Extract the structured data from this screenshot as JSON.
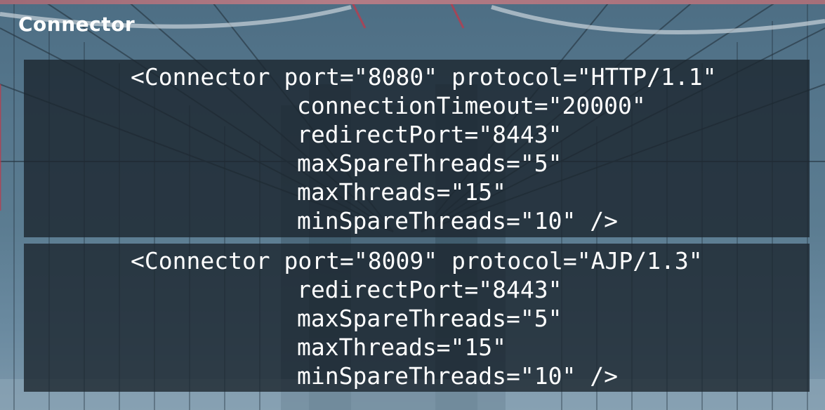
{
  "slide": {
    "title": "Connector",
    "code_blocks": [
      {
        "lines": [
          "<Connector port=\"8080\" protocol=\"HTTP/1.1\"",
          "connectionTimeout=\"20000\"",
          "redirectPort=\"8443\"",
          "maxSpareThreads=\"5\"",
          "maxThreads=\"15\"",
          "minSpareThreads=\"10\" />"
        ]
      },
      {
        "lines": [
          "<Connector port=\"8009\" protocol=\"AJP/1.3\"",
          "redirectPort=\"8443\"",
          "maxSpareThreads=\"5\"",
          "maxThreads=\"15\"",
          "minSpareThreads=\"10\" />"
        ]
      }
    ]
  },
  "colors": {
    "title_text": "#ffffff",
    "code_text": "#ffffff",
    "panel_background": "#1c262e",
    "sky_background": "#56778d"
  }
}
